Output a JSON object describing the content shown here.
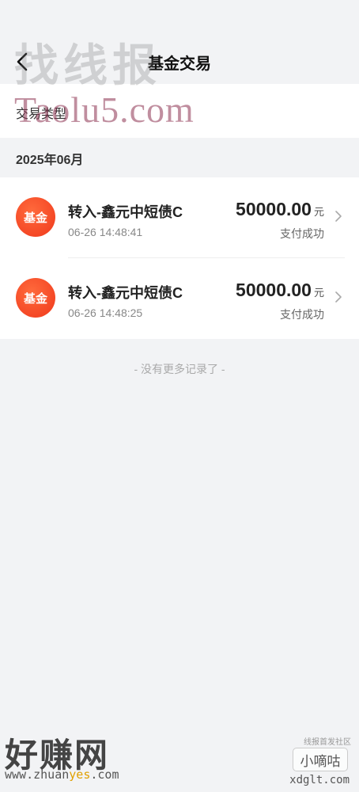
{
  "header": {
    "title": "基金交易",
    "back_icon": "chevron-left-icon"
  },
  "filter": {
    "label": "交易类型"
  },
  "month_label": "2025年06月",
  "transactions": [
    {
      "badge": "基金",
      "name": "转入-鑫元中短债C",
      "time": "06-26 14:48:41",
      "amount": "50000.00",
      "unit": "元",
      "status": "支付成功"
    },
    {
      "badge": "基金",
      "name": "转入-鑫元中短债C",
      "time": "06-26 14:48:25",
      "amount": "50000.00",
      "unit": "元",
      "status": "支付成功"
    }
  ],
  "footer_text": "- 没有更多记录了 -",
  "watermarks": {
    "top_cn": "找线报",
    "top_en": "Taolu5.com",
    "bottom_left_cn": "好赚网",
    "bottom_left_url_a": "www.zhuan",
    "bottom_left_url_hl": "yes",
    "bottom_left_url_b": ".com",
    "bottom_right_small": "线报首发社区",
    "bottom_right_box": "小嘀咕",
    "bottom_right_url": "xdglt.com"
  },
  "colors": {
    "badge": "#f0391c",
    "background": "#f2f3f5"
  }
}
